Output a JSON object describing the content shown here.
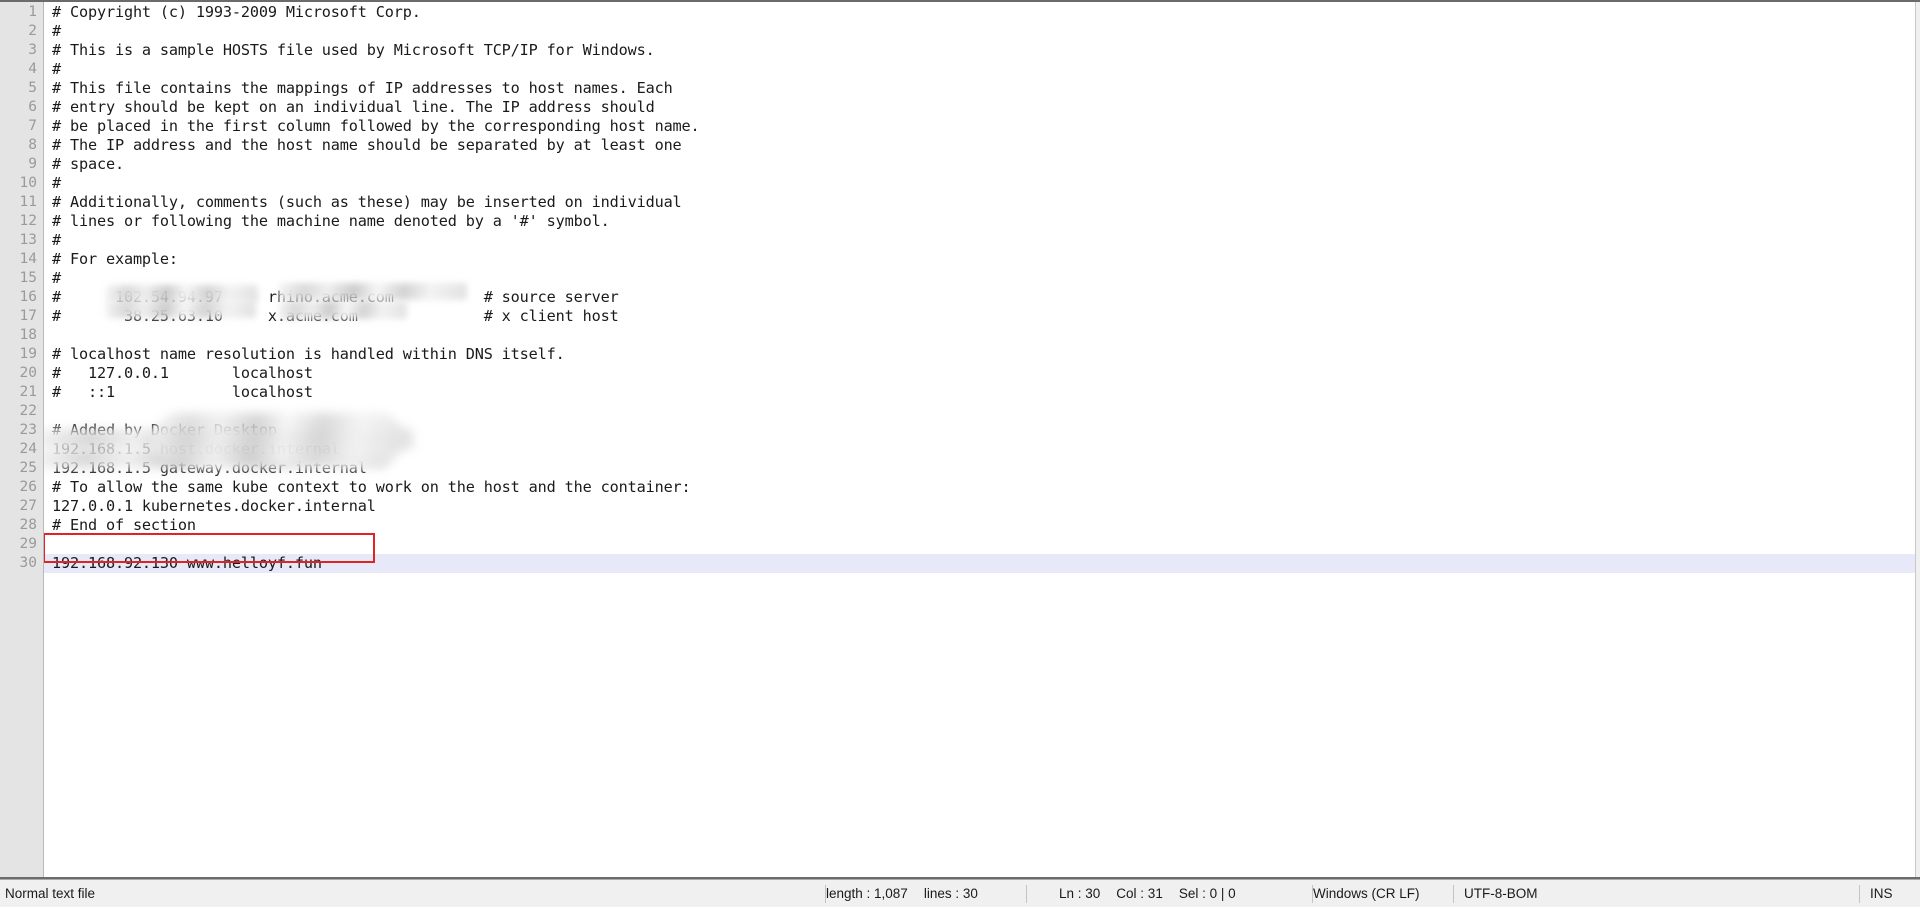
{
  "app": {
    "kind": "text-editor",
    "file_kind": "hosts-file"
  },
  "editor": {
    "total_lines": 30,
    "current_line": 30,
    "lines": [
      {
        "n": "1",
        "text": "# Copyright (c) 1993-2009 Microsoft Corp."
      },
      {
        "n": "2",
        "text": "#"
      },
      {
        "n": "3",
        "text": "# This is a sample HOSTS file used by Microsoft TCP/IP for Windows."
      },
      {
        "n": "4",
        "text": "#"
      },
      {
        "n": "5",
        "text": "# This file contains the mappings of IP addresses to host names. Each"
      },
      {
        "n": "6",
        "text": "# entry should be kept on an individual line. The IP address should"
      },
      {
        "n": "7",
        "text": "# be placed in the first column followed by the corresponding host name."
      },
      {
        "n": "8",
        "text": "# The IP address and the host name should be separated by at least one"
      },
      {
        "n": "9",
        "text": "# space."
      },
      {
        "n": "10",
        "text": "#"
      },
      {
        "n": "11",
        "text": "# Additionally, comments (such as these) may be inserted on individual"
      },
      {
        "n": "12",
        "text": "# lines or following the machine name denoted by a '#' symbol."
      },
      {
        "n": "13",
        "text": "#"
      },
      {
        "n": "14",
        "text": "# For example:"
      },
      {
        "n": "15",
        "text": "#"
      },
      {
        "n": "16",
        "text": "#      102.54.94.97     rhino.acme.com          # source server"
      },
      {
        "n": "17",
        "text": "#       38.25.63.10     x.acme.com              # x client host"
      },
      {
        "n": "18",
        "text": ""
      },
      {
        "n": "19",
        "text": "# localhost name resolution is handled within DNS itself."
      },
      {
        "n": "20",
        "text": "#   127.0.0.1       localhost"
      },
      {
        "n": "21",
        "text": "#   ::1             localhost"
      },
      {
        "n": "22",
        "text": ""
      },
      {
        "n": "23",
        "text": "# Added by Docker Desktop"
      },
      {
        "n": "24",
        "text": "192.168.1.5 host.docker.internal"
      },
      {
        "n": "25",
        "text": "192.168.1.5 gateway.docker.internal"
      },
      {
        "n": "26",
        "text": "# To allow the same kube context to work on the host and the container:"
      },
      {
        "n": "27",
        "text": "127.0.0.1 kubernetes.docker.internal"
      },
      {
        "n": "28",
        "text": "# End of section"
      },
      {
        "n": "29",
        "text": ""
      },
      {
        "n": "30",
        "text": "192.168.92.130 www.helloyf.fun"
      }
    ],
    "redacted_lines": [
      16,
      17,
      24,
      25
    ],
    "annotation": {
      "type": "red-rectangle",
      "target_line": 30,
      "color": "#e02424"
    },
    "highlight_color": "#e8e9f8"
  },
  "statusbar": {
    "file_type": "Normal text file",
    "length_label": "length : 1,087",
    "lines_label": "lines : 30",
    "ln_label": "Ln : 30",
    "col_label": "Col : 31",
    "sel_label": "Sel : 0 | 0",
    "eol": "Windows (CR LF)",
    "encoding": "UTF-8-BOM",
    "insert_mode": "INS"
  }
}
